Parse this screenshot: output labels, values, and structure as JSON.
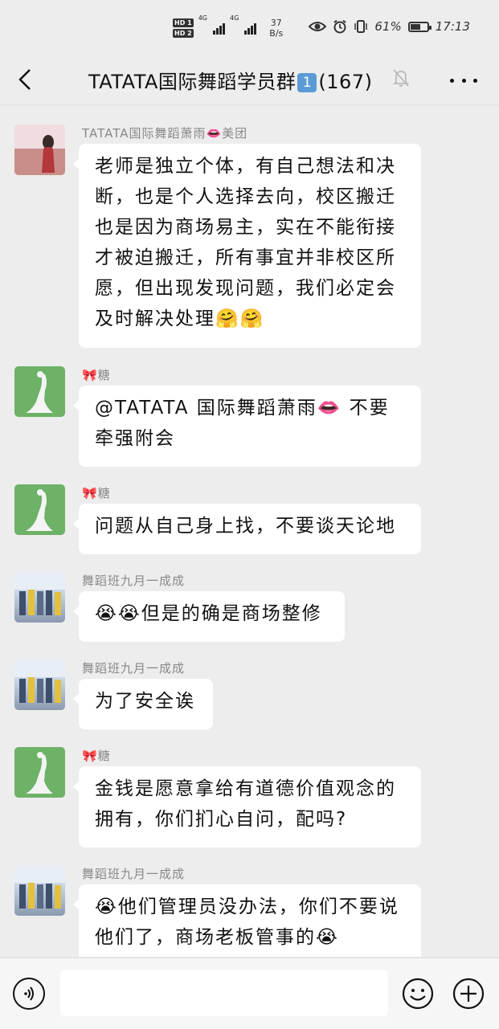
{
  "status_bar": {
    "hd1": "HD 1",
    "hd2": "HD 2",
    "net1": "4G",
    "net2": "4G",
    "speed_value": "37",
    "speed_unit": "B/s",
    "battery_percent": "61%",
    "battery_level": 0.61,
    "time": "17:13"
  },
  "header": {
    "title_prefix": "TATATA国际舞蹈学员群",
    "title_badge": "1",
    "member_count": "(167)"
  },
  "messages": [
    {
      "sender": "TATATA国际舞蹈萧雨👄美团",
      "text": "老师是独立个体，有自己想法和决断，也是个人选择去向，校区搬迁也是因为商场易主，实在不能衔接才被迫搬迁，所有事宜并非校区所愿，但出现发现问题，我们必定会及时解决处理🤗🤗"
    },
    {
      "sender": "🎀糖",
      "text": "@TATATA 国际舞蹈萧雨👄 不要牵强附会"
    },
    {
      "sender": "🎀糖",
      "text": "问题从自己身上找，不要谈天论地"
    },
    {
      "sender": "舞蹈班九月一成成",
      "text": "😭😭但是的确是商场整修"
    },
    {
      "sender": "舞蹈班九月一成成",
      "text": "为了安全诶"
    },
    {
      "sender": "🎀糖",
      "text": "金钱是愿意拿给有道德价值观念的拥有，你们扪心自问，配吗?"
    },
    {
      "sender": "舞蹈班九月一成成",
      "text": "😭他们管理员没办法，你们不要说他们了，商场老板管事的😭"
    }
  ],
  "input_bar": {
    "placeholder": ""
  },
  "colors": {
    "background": "#ededed",
    "bubble": "#ffffff",
    "name_text": "#888888",
    "green_avatar": "#6db267"
  }
}
